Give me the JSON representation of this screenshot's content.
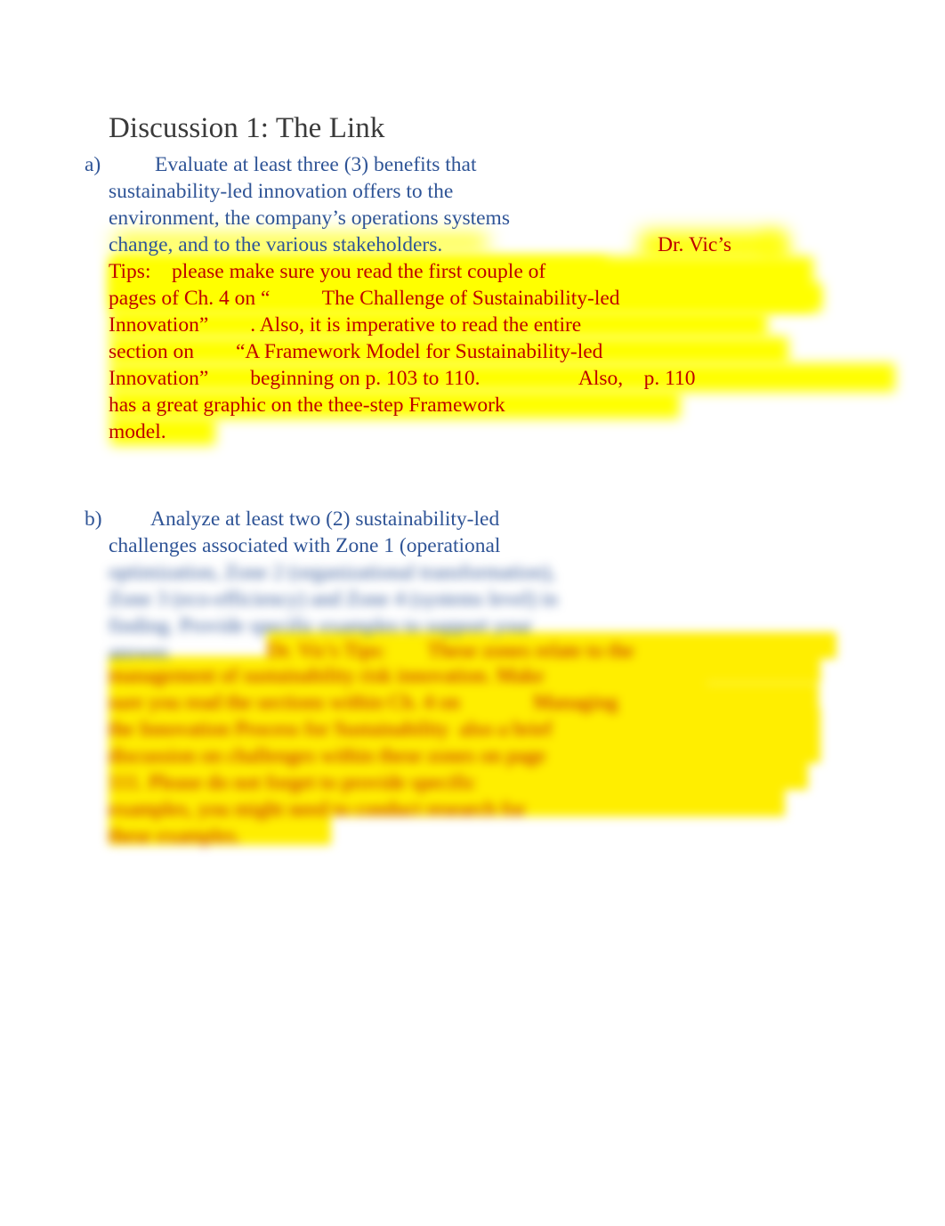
{
  "document": {
    "title": "Discussion 1: The Link",
    "background_color": "#ffffff",
    "title_color": "#3a3a3a",
    "body_blue_color": "#2f5496",
    "tips_red_color": "#be0000",
    "highlight_color": "#ffff00"
  },
  "items": [
    {
      "marker": "a)",
      "prompt_lines": [
        "Evaluate at least three (3) benefits that",
        "sustainability-led innovation offers to the",
        "environment, the company’s operations systems",
        "change, and to the various stakeholders."
      ],
      "prompt_text": "Evaluate at least three (3) benefits that sustainability-led innovation offers to the environment, the company’s operations systems change, and to the various stakeholders.",
      "tips_label": "Dr. Vic’s",
      "tips_lines": [
        "Dr. Vic’s",
        "Tips:    please make sure you read the first couple of",
        "pages of Ch. 4 on “          The Challenge of Sustainability-led",
        "Innovation”        . Also, it is imperative to read the entire",
        "section on        “A Framework Model for Sustainability-led",
        "Innovation”        beginning on p. 103 to 110.                   Also,    p. 110",
        "has a great graphic on the thee-step Framework",
        "model."
      ],
      "tips_text": "Dr. Vic’s Tips: please make sure you read the first couple of pages of Ch. 4 on “The Challenge of Sustainability-led Innovation”. Also, it is imperative to read the entire section on “A Framework Model for Sustainability-led Innovation” beginning on p. 103 to 110. Also, p. 110 has a great graphic on the thee-step Framework model.",
      "highlighted": true
    },
    {
      "marker": "b)",
      "prompt_lines": [
        "Analyze at least two (2) sustainability-led",
        "challenges associated with Zone 1 (operational"
      ],
      "prompt_text": "Analyze at least two (2) sustainability-led challenges associated with Zone 1 (operational",
      "redacted": true,
      "redaction_note": "remaining text is blurred and illegible",
      "highlighted": true
    }
  ],
  "redacted_region": {
    "blue_line_count": 4,
    "highlighted_line_count": 8,
    "legible": false
  }
}
